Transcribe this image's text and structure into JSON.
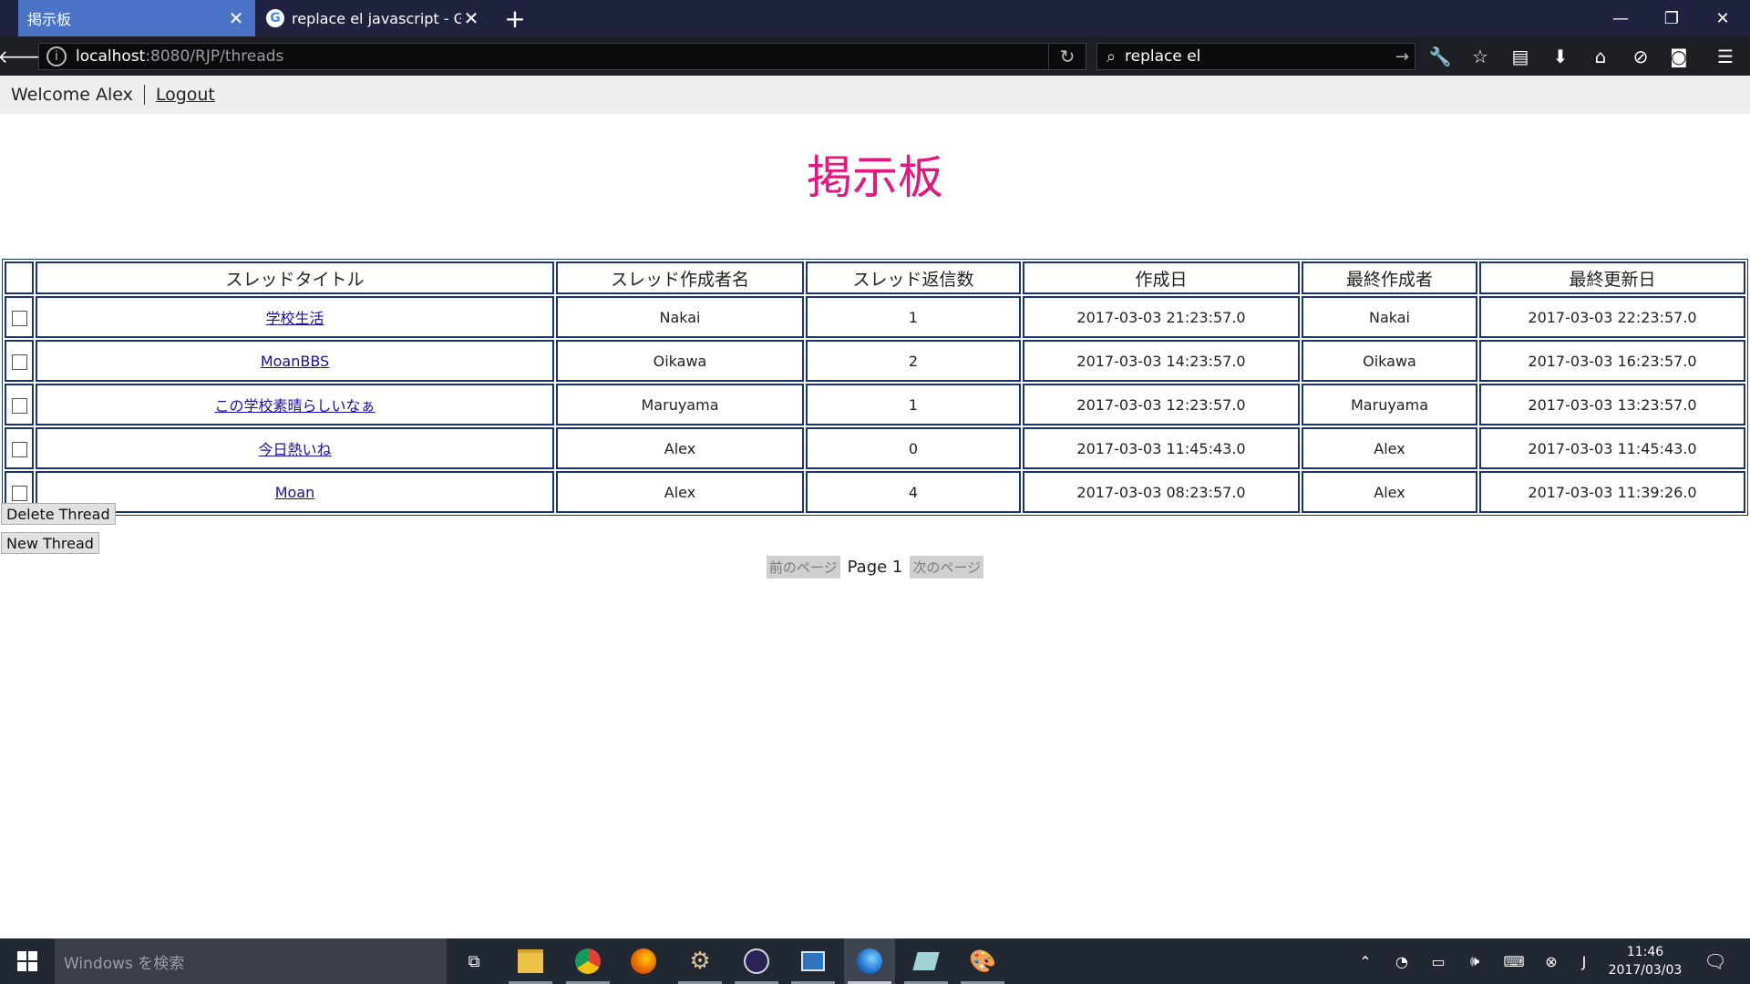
{
  "browser": {
    "tabs": [
      {
        "title": "掲示板",
        "active": true
      },
      {
        "title": "replace el javascript - Googl",
        "active": false
      }
    ],
    "url_host": "localhost",
    "url_rest": ":8080/RJP/threads",
    "search_value": "replace el"
  },
  "userbar": {
    "welcome": "Welcome Alex",
    "logout": "Logout"
  },
  "page": {
    "title": "掲示板"
  },
  "table": {
    "headers": [
      "スレッドタイトル",
      "スレッド作成者名",
      "スレッド返信数",
      "作成日",
      "最終作成者",
      "最終更新日"
    ],
    "rows": [
      {
        "title": "学校生活",
        "author": "Nakai",
        "replies": "1",
        "created": "2017-03-03 21:23:57.0",
        "last_author": "Nakai",
        "updated": "2017-03-03 22:23:57.0"
      },
      {
        "title": "MoanBBS",
        "author": "Oikawa",
        "replies": "2",
        "created": "2017-03-03 14:23:57.0",
        "last_author": "Oikawa",
        "updated": "2017-03-03 16:23:57.0"
      },
      {
        "title": "この学校素晴らしいなぁ",
        "author": "Maruyama",
        "replies": "1",
        "created": "2017-03-03 12:23:57.0",
        "last_author": "Maruyama",
        "updated": "2017-03-03 13:23:57.0"
      },
      {
        "title": "今日熱いね",
        "author": "Alex",
        "replies": "0",
        "created": "2017-03-03 11:45:43.0",
        "last_author": "Alex",
        "updated": "2017-03-03 11:45:43.0"
      },
      {
        "title": "Moan",
        "author": "Alex",
        "replies": "4",
        "created": "2017-03-03 08:23:57.0",
        "last_author": "Alex",
        "updated": "2017-03-03 11:39:26.0"
      }
    ]
  },
  "actions": {
    "delete_label": "Delete Thread",
    "new_label": "New Thread"
  },
  "pager": {
    "prev": "前のページ",
    "label": "Page 1",
    "next": "次のページ"
  },
  "taskbar": {
    "search_placeholder": "Windows を検索",
    "time": "11:46",
    "date": "2017/03/03"
  },
  "colors": {
    "title": "#e6157f",
    "table_border": "#1a3478",
    "active_tab": "#4a73c7"
  }
}
